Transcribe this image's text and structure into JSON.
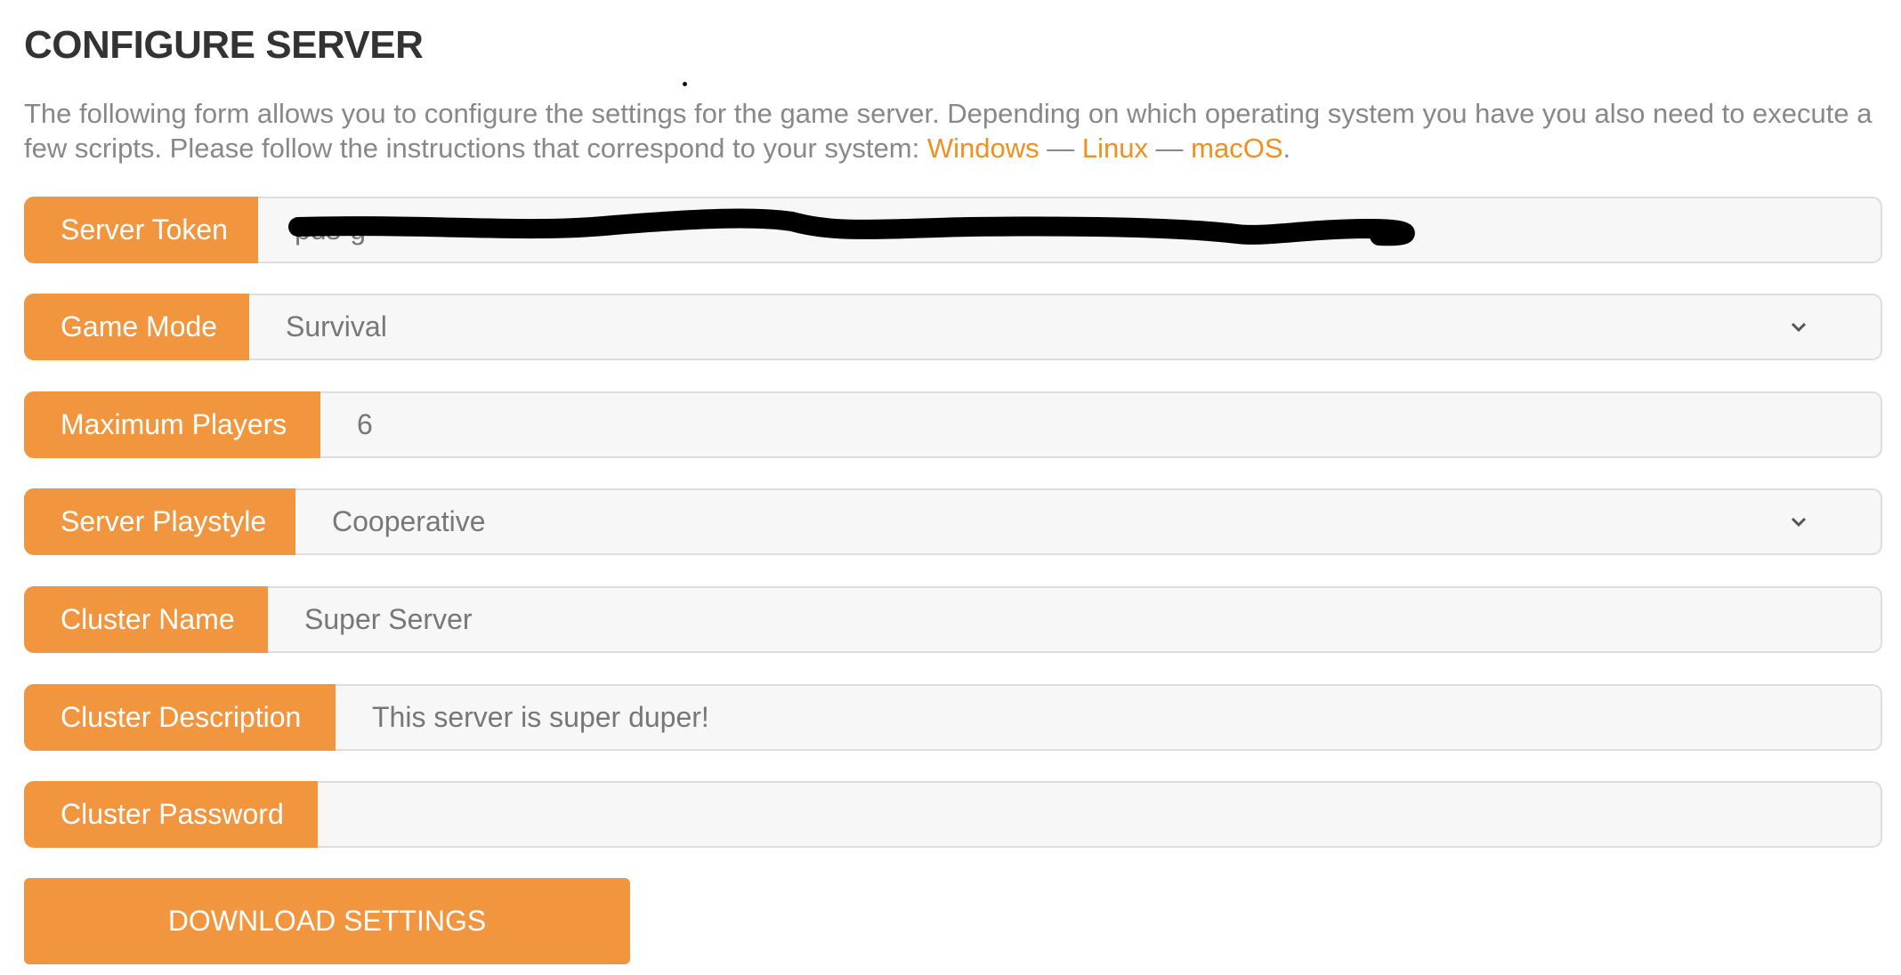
{
  "title": "CONFIGURE SERVER",
  "description": {
    "text": "The following form allows you to configure the settings for the game server. Depending on which operating system you have you also need to execute a few scripts. Please follow the instructions that correspond to your system: ",
    "links": [
      "Windows",
      "Linux",
      "macOS"
    ],
    "separator": " — ",
    "end": "."
  },
  "form": {
    "fields": [
      {
        "label": "Server Token",
        "value": "pds-g",
        "type": "text",
        "redacted": true
      },
      {
        "label": "Game Mode",
        "value": "Survival",
        "type": "select"
      },
      {
        "label": "Maximum Players",
        "value": "6",
        "type": "text"
      },
      {
        "label": "Server Playstyle",
        "value": "Cooperative",
        "type": "select"
      },
      {
        "label": "Cluster Name",
        "value": "Super Server",
        "type": "text"
      },
      {
        "label": "Cluster Description",
        "value": "This server is super duper!",
        "type": "text"
      },
      {
        "label": "Cluster Password",
        "value": "",
        "type": "password"
      }
    ],
    "submit_label": "DOWNLOAD SETTINGS"
  },
  "colors": {
    "accent": "#f1963f",
    "link": "#f0901e",
    "field_bg": "#f7f7f7",
    "text": "#777777"
  },
  "icons": {
    "select": "chevron-down-icon"
  }
}
